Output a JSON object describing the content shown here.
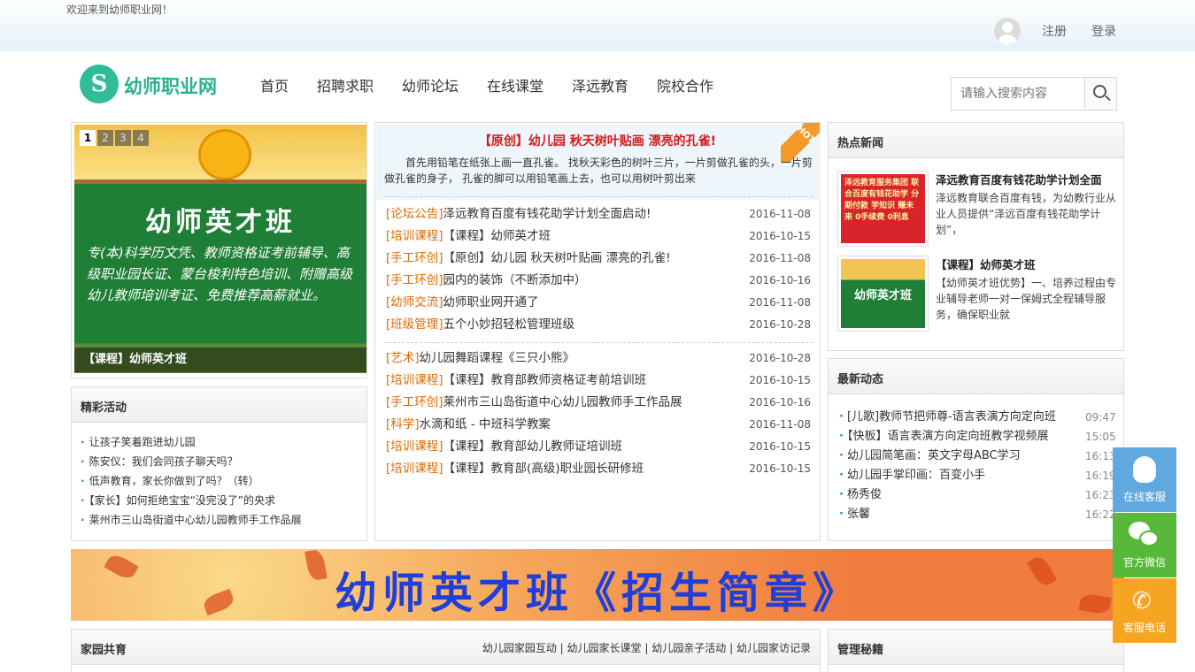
{
  "header": {
    "welcome": "欢迎来到幼师职业网！",
    "register": "注册",
    "login": "登录"
  },
  "logo": {
    "mark": "S",
    "text": "幼师职业网"
  },
  "nav": [
    "首页",
    "招聘求职",
    "幼师论坛",
    "在线课堂",
    "泽远教育",
    "院校合作"
  ],
  "search": {
    "placeholder": "请输入搜索内容",
    "icon": "search-icon"
  },
  "slider": {
    "pages": [
      "1",
      "2",
      "3",
      "4"
    ],
    "active_page": "1",
    "board_title": "幼师英才班",
    "board_text": "专(本)科学历文凭、教师资格证考前辅导、高级职业园长证、蒙台梭利特色培训、附赠高级幼儿教师培训考证、免费推荐高薪就业。",
    "caption": "【课程】幼师英才班"
  },
  "activities": {
    "title": "精彩活动",
    "items": [
      "让孩子笑着跑进幼儿园",
      "陈安仪：我们会同孩子聊天吗？",
      "低声教育，家长你做到了吗？（转）",
      "【家长】如何拒绝宝宝“没完没了”的央求",
      "莱州市三山岛街道中心幼儿园教师手工作品展"
    ]
  },
  "center": {
    "hot_badge": "HOT",
    "headline": "【原创】幼儿园 秋天树叶贴画 漂亮的孔雀!",
    "summary": "首先用铅笔在纸张上画一直孔雀。 找秋天彩色的树叶三片，一片剪做孔雀的头，一片剪做孔雀的身子， 孔雀的脚可以用铅笔画上去，也可以用树叶剪出来",
    "news_group1": [
      {
        "cat": "[论坛公告]",
        "title": "泽远教育百度有钱花助学计划全面启动!",
        "date": "2016-11-08"
      },
      {
        "cat": "[培训课程]",
        "title": "【课程】幼师英才班",
        "date": "2016-10-15"
      },
      {
        "cat": "[手工环创]",
        "title": "【原创】幼儿园 秋天树叶贴画 漂亮的孔雀!",
        "date": "2016-11-08"
      },
      {
        "cat": "[手工环创]",
        "title": "园内的装饰（不断添加中）",
        "date": "2016-10-16"
      },
      {
        "cat": "[幼师交流]",
        "title": "幼师职业网开通了",
        "date": "2016-11-08"
      },
      {
        "cat": "[班级管理]",
        "title": "五个小妙招轻松管理班级",
        "date": "2016-10-28"
      }
    ],
    "news_group2": [
      {
        "cat": "[艺术]",
        "title": "幼儿园舞蹈课程《三只小熊》",
        "date": "2016-10-28"
      },
      {
        "cat": "[培训课程]",
        "title": "【课程】教育部教师资格证考前培训班",
        "date": "2016-10-15"
      },
      {
        "cat": "[手工环创]",
        "title": "莱州市三山岛街道中心幼儿园教师手工作品展",
        "date": "2016-10-16"
      },
      {
        "cat": "[科学]",
        "title": "水滴和纸 - 中班科学教案",
        "date": "2016-11-08"
      },
      {
        "cat": "[培训课程]",
        "title": "【课程】教育部幼儿教师证培训班",
        "date": "2016-10-15"
      },
      {
        "cat": "[培训课程]",
        "title": "【课程】教育部(高级)职业园长研修班",
        "date": "2016-10-15"
      }
    ]
  },
  "hot_news": {
    "title": "热点新闻",
    "items": [
      {
        "title": "泽远教育百度有钱花助学计划全面",
        "desc": "泽远教育联合百度有钱，为幼教行业从业人员提供“泽远百度有钱花助学计划”，",
        "thumb_text": "泽远教育服务集团 联合百度有钱花助学 分期付款 学知识 赚未来 0手续费 0利息"
      },
      {
        "title": "【课程】幼师英才班",
        "desc": "【幼师英才班优势】一、培养过程由专业辅导老师一对一保姆式全程辅导服务，确保职业就",
        "thumb_text": "幼师英才班"
      }
    ]
  },
  "latest": {
    "title": "最新动态",
    "items": [
      {
        "text": "[儿歌]教师节把师尊-语言表演方向定向班",
        "time": "09:47"
      },
      {
        "text": "【快板】语言表演方向定向班教学视频展",
        "time": "15:05"
      },
      {
        "text": "幼儿园简笔画：英文字母ABC学习",
        "time": "16:13"
      },
      {
        "text": "幼儿园手掌印画：百变小手",
        "time": "16:19"
      },
      {
        "text": "杨秀俊",
        "time": "16:23"
      },
      {
        "text": "张馨",
        "time": "16:22"
      }
    ]
  },
  "banner": {
    "text": "幼师英才班《招生简章》"
  },
  "home_edu": {
    "title": "家园共育",
    "links": [
      "幼儿园家园互动",
      "幼儿园家长课堂",
      "幼儿园亲子活动",
      "幼儿园家访记录"
    ],
    "separator": "|"
  },
  "management": {
    "title": "管理秘籍"
  },
  "side_buttons": [
    {
      "label": "在线客服",
      "icon": "qq-icon",
      "color": "#5fa8e0"
    },
    {
      "label": "官方微信",
      "icon": "wechat-icon",
      "color": "#58b83a"
    },
    {
      "label": "客服电话",
      "icon": "phone-icon",
      "color": "#f6a523"
    }
  ],
  "colors": {
    "brand": "#2fbc99",
    "category": "#e06a00",
    "headline": "#d51b1b",
    "bullet": "#1a8fd8"
  }
}
